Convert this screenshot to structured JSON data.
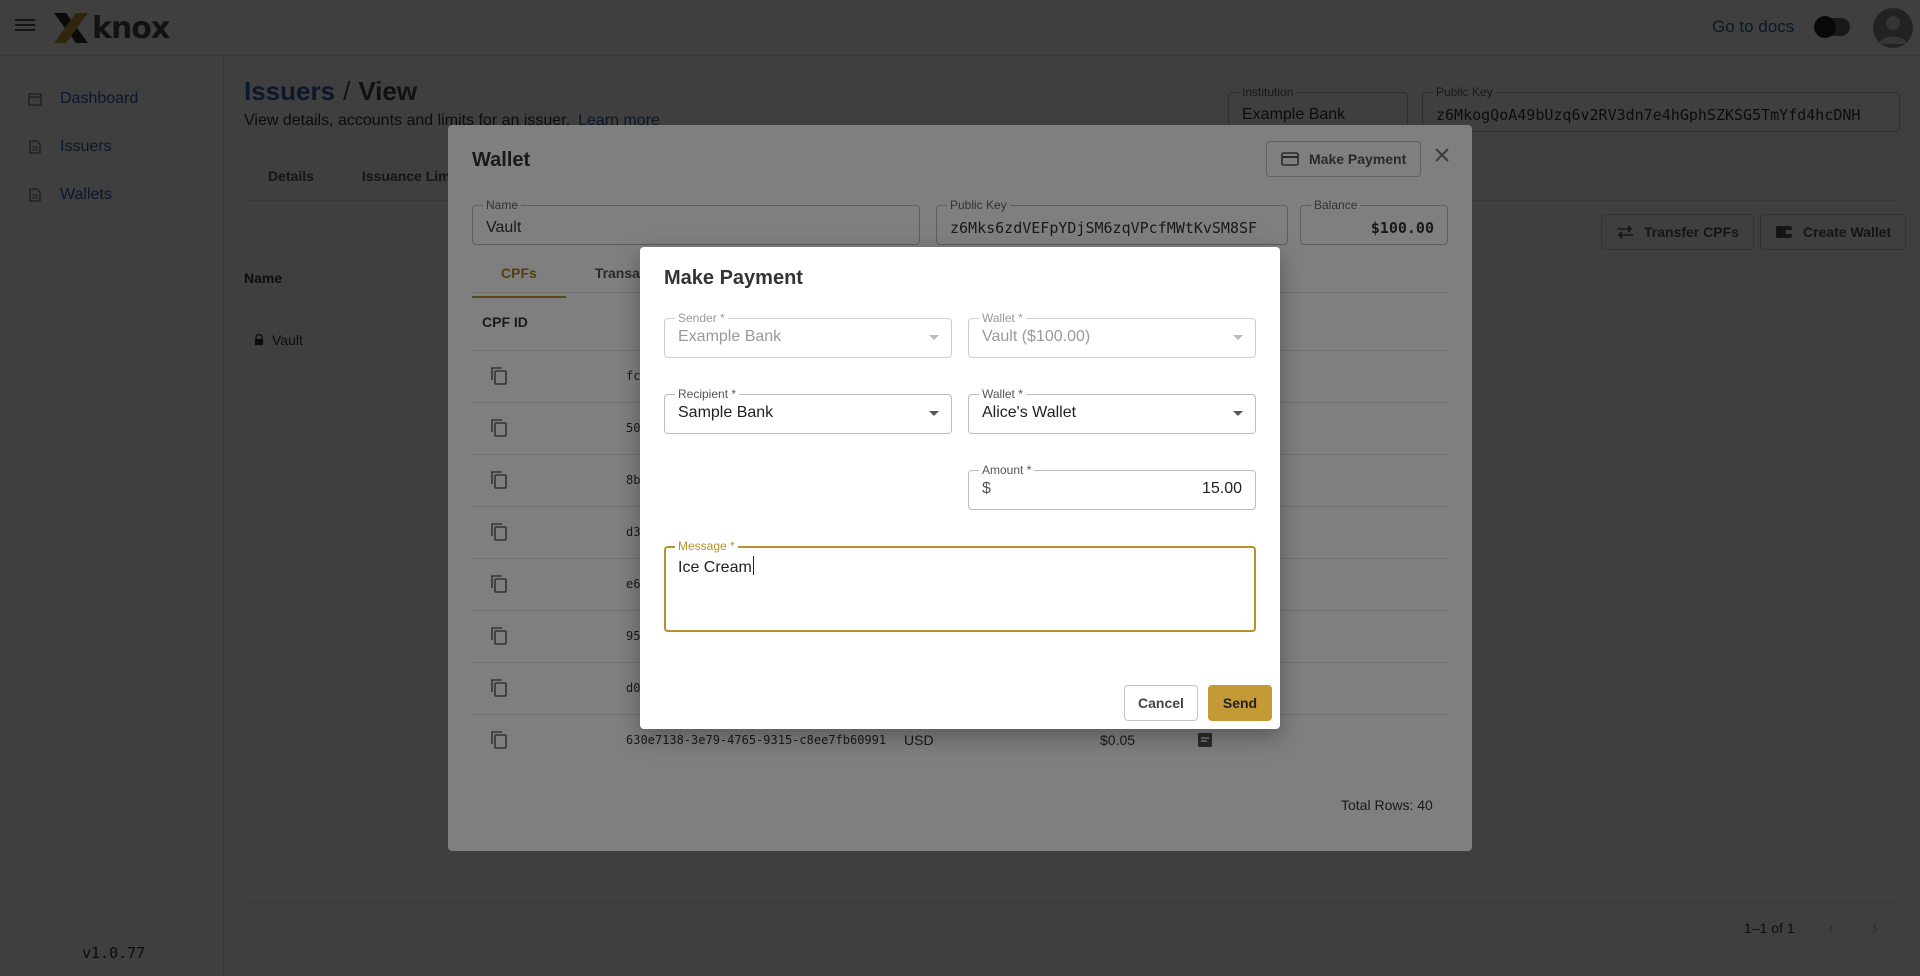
{
  "appbar": {
    "brand": "knox",
    "docs_link": "Go to docs",
    "icons": [
      "menu-icon",
      "knox-logo",
      "theme-toggle",
      "account-icon"
    ]
  },
  "sidebar": {
    "items": [
      {
        "label": "Dashboard",
        "icon": "calendar-icon"
      },
      {
        "label": "Issuers",
        "icon": "document-icon"
      },
      {
        "label": "Wallets",
        "icon": "document-icon"
      }
    ],
    "version": "v1.0.77"
  },
  "page": {
    "breadcrumb_link": "Issuers",
    "breadcrumb_sep": "/",
    "breadcrumb_current": "View",
    "subtitle": "View details, accounts and limits for an issuer.",
    "learn_more": "Learn more",
    "institution": {
      "label": "Institution",
      "value": "Example Bank"
    },
    "public_key": {
      "label": "Public Key",
      "value": "z6MkogQoA49bUzq6v2RV3dn7e4hGphSZKSG5TmYfd4hcDNH"
    },
    "tabs": [
      "Details",
      "Issuance Limit"
    ],
    "transfer_button": "Transfer CPFs",
    "create_wallet_button": "Create Wallet",
    "table_header_name": "Name",
    "row_name": "Vault",
    "pagination": "1–1 of 1"
  },
  "wallet_dialog": {
    "title": "Wallet",
    "make_payment_button": "Make Payment",
    "name": {
      "label": "Name",
      "value": "Vault"
    },
    "public_key": {
      "label": "Public Key",
      "value": "z6Mks6zdVEFpYDjSM6zqVPcfMWtKvSM8SF"
    },
    "balance": {
      "label": "Balance",
      "value": "$100.00"
    },
    "tabs": [
      "CPFs",
      "Transactions"
    ],
    "cpf_header": "CPF ID",
    "rows": [
      {
        "id": "fc",
        "currency": "",
        "amount": ""
      },
      {
        "id": "50",
        "currency": "",
        "amount": ""
      },
      {
        "id": "8b",
        "currency": "",
        "amount": ""
      },
      {
        "id": "d3",
        "currency": "",
        "amount": ""
      },
      {
        "id": "e6",
        "currency": "",
        "amount": ""
      },
      {
        "id": "95",
        "currency": "",
        "amount": ""
      },
      {
        "id": "d0",
        "currency": "",
        "amount": ""
      },
      {
        "id": "630e7138-3e79-4765-9315-c8ee7fb60991",
        "currency": "USD",
        "amount": "$0.05"
      }
    ],
    "total_rows": "Total Rows: 40"
  },
  "payment_dialog": {
    "title": "Make Payment",
    "sender": {
      "label": "Sender *",
      "value": "Example Bank"
    },
    "sender_wallet": {
      "label": "Wallet *",
      "value": "Vault ($100.00)"
    },
    "recipient": {
      "label": "Recipient *",
      "value": "Sample Bank"
    },
    "recipient_wallet": {
      "label": "Wallet *",
      "value": "Alice's Wallet"
    },
    "amount": {
      "label": "Amount *",
      "prefix": "$",
      "value": "15.00"
    },
    "message": {
      "label": "Message *",
      "value": "Ice Cream"
    },
    "cancel": "Cancel",
    "send": "Send"
  },
  "colors": {
    "link": "#2d5fa8",
    "accent_gold": "#c39a35",
    "focus_gold": "#b88f2b"
  }
}
